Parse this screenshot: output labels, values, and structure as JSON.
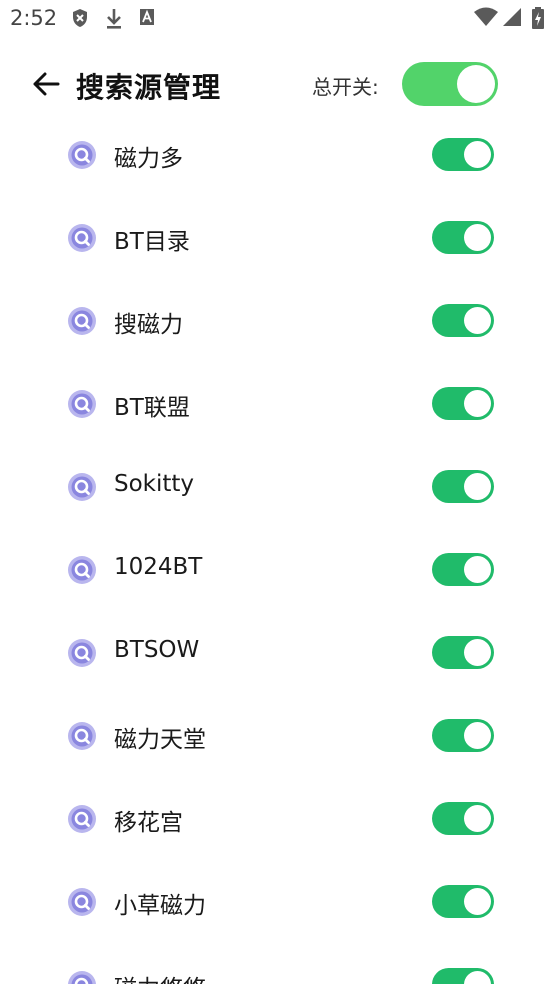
{
  "status_bar": {
    "time": "2:52",
    "left_icons": [
      "shield-icon",
      "download-icon",
      "a-box-icon"
    ],
    "right_icons": [
      "wifi-icon",
      "cellular-icon",
      "battery-charging-icon"
    ]
  },
  "header": {
    "title": "搜索源管理",
    "back_icon": "arrow-left-icon",
    "master_switch_label": "总开关:",
    "master_switch_on": true,
    "master_switch_color": "#52d36a"
  },
  "colors": {
    "switch_on": "#20bb6a",
    "icon_accent": "#8a86df"
  },
  "sources": [
    {
      "name": "磁力多",
      "enabled": true,
      "icon": "search-source-icon"
    },
    {
      "name": "BT目录",
      "enabled": true,
      "icon": "search-source-icon"
    },
    {
      "name": "搜磁力",
      "enabled": true,
      "icon": "search-source-icon"
    },
    {
      "name": "BT联盟",
      "enabled": true,
      "icon": "search-source-icon"
    },
    {
      "name": "Sokitty",
      "enabled": true,
      "icon": "search-source-icon"
    },
    {
      "name": "1024BT",
      "enabled": true,
      "icon": "search-source-icon"
    },
    {
      "name": "BTSOW",
      "enabled": true,
      "icon": "search-source-icon"
    },
    {
      "name": "磁力天堂",
      "enabled": true,
      "icon": "search-source-icon"
    },
    {
      "name": "移花宫",
      "enabled": true,
      "icon": "search-source-icon"
    },
    {
      "name": "小草磁力",
      "enabled": true,
      "icon": "search-source-icon"
    },
    {
      "name": "磁力悠悠",
      "enabled": true,
      "icon": "search-source-icon"
    }
  ]
}
